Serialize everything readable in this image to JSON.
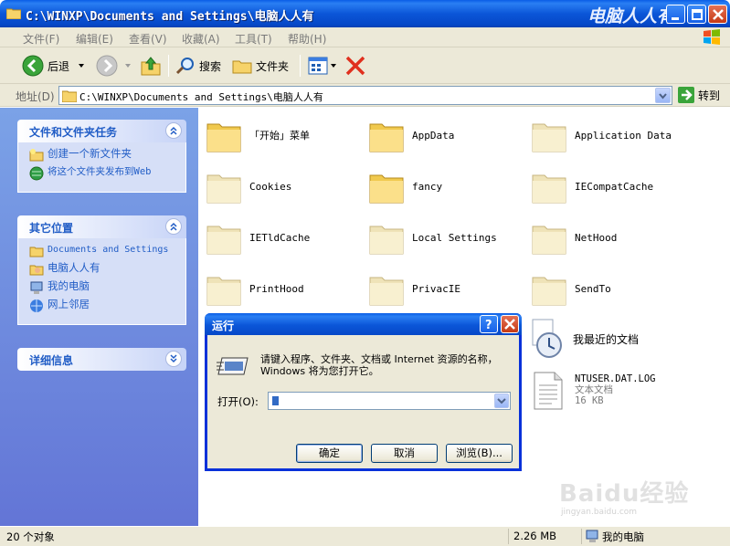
{
  "window": {
    "title": "C:\\WINXP\\Documents and Settings\\电脑人人有",
    "corner_text": "电脑人人有"
  },
  "menu": [
    "文件(F)",
    "编辑(E)",
    "查看(V)",
    "收藏(A)",
    "工具(T)",
    "帮助(H)"
  ],
  "toolbar": {
    "back": "后退",
    "search": "搜索",
    "folders": "文件夹"
  },
  "address": {
    "label": "地址(D)",
    "value": "C:\\WINXP\\Documents and Settings\\电脑人人有",
    "go": "转到"
  },
  "panels": {
    "tasks": {
      "title": "文件和文件夹任务",
      "items": [
        "创建一个新文件夹",
        "将这个文件夹发布到Web"
      ]
    },
    "places": {
      "title": "其它位置",
      "items": [
        "Documents and Settings",
        "电脑人人有",
        "我的电脑",
        "网上邻居"
      ]
    },
    "details": {
      "title": "详细信息"
    }
  },
  "files": [
    "「开始」菜单",
    "AppData",
    "Application Data",
    "Cookies",
    "fancy",
    "IECompatCache",
    "IETldCache",
    "Local Settings",
    "NetHood",
    "PrintHood",
    "PrivacIE",
    "SendTo",
    "我最近的文档"
  ],
  "ntuser": {
    "name": "NTUSER.DAT.LOG",
    "type": "文本文档",
    "size": "16 KB"
  },
  "status": {
    "count": "20 个对象",
    "size": "2.26 MB",
    "location": "我的电脑"
  },
  "run_dialog": {
    "title": "运行",
    "message": "请键入程序、文件夹、文档或 Internet 资源的名称，Windows 将为您打开它。",
    "open_label": "打开(O):",
    "ok": "确定",
    "cancel": "取消",
    "browse": "浏览(B)..."
  },
  "watermark": {
    "logo": "Baidu经验",
    "url": "jingyan.baidu.com"
  },
  "colors": {
    "titlebar": "#0b56d8",
    "taskpane": "#7ba2e7",
    "link": "#215dc6",
    "chrome": "#ece9d8"
  }
}
